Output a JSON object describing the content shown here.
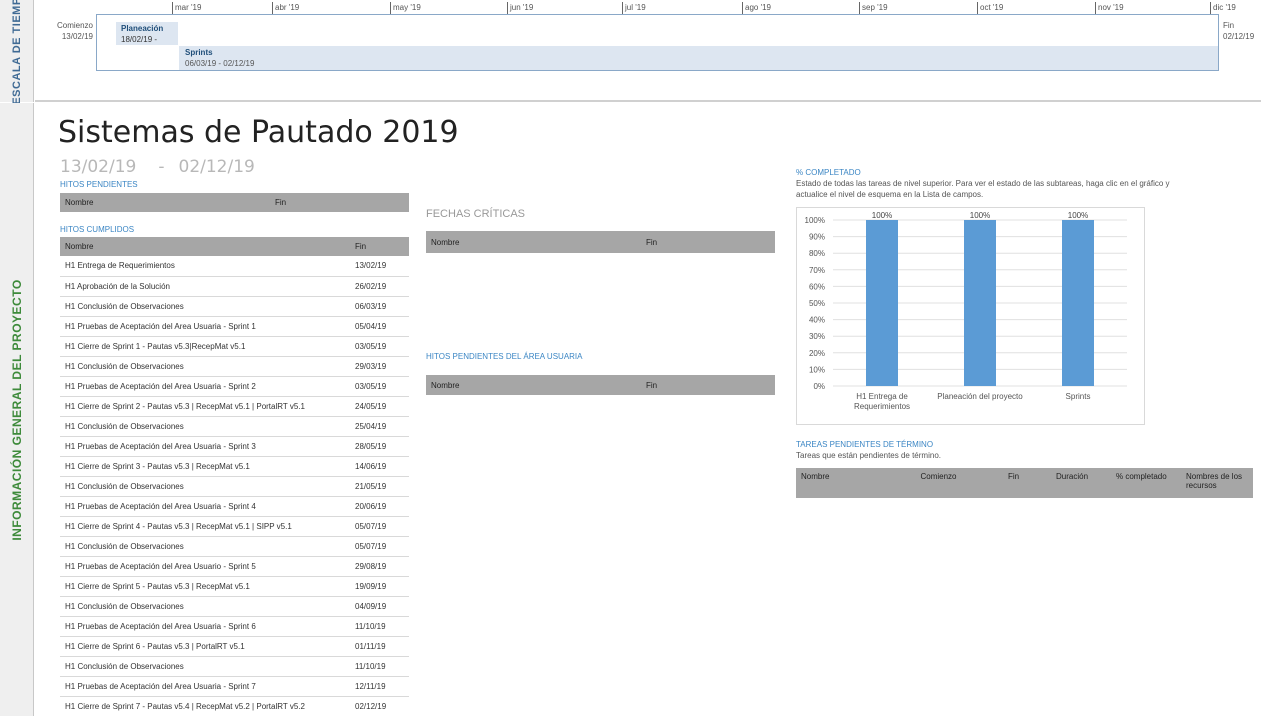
{
  "sidebar": {
    "timeline_label": "ESCALA DE TIEMP",
    "info_label": "INFORMACIÓN GENERAL DEL PROYECTO"
  },
  "timeline": {
    "months": [
      "mar '19",
      "abr '19",
      "may '19",
      "jun '19",
      "jul '19",
      "ago '19",
      "sep '19",
      "oct '19",
      "nov '19",
      "dic '19"
    ],
    "start_label": "Comienzo",
    "start_date": "13/02/19",
    "end_label": "Fin",
    "end_date": "02/12/19",
    "planeacion": {
      "name": "Planeación",
      "dates": "18/02/19 -"
    },
    "sprints": {
      "name": "Sprints",
      "dates": "06/03/19 - 02/12/19"
    }
  },
  "project": {
    "title": "Sistemas de Pautado 2019",
    "start": "13/02/19",
    "sep": "-",
    "end": "02/12/19"
  },
  "hitos_pendientes": {
    "heading": "HITOS PENDIENTES",
    "col_nombre": "Nombre",
    "col_fin": "Fin"
  },
  "hitos_cumplidos": {
    "heading": "HITOS CUMPLIDOS",
    "col_nombre": "Nombre",
    "col_fin": "Fin",
    "rows": [
      {
        "nombre": "H1 Entrega de Requerimientos",
        "fin": "13/02/19"
      },
      {
        "nombre": "H1 Aprobación de la Solución",
        "fin": "26/02/19"
      },
      {
        "nombre": "H1 Conclusión de Observaciones",
        "fin": "06/03/19"
      },
      {
        "nombre": "H1 Pruebas de Aceptación del Area Usuaria - Sprint 1",
        "fin": "05/04/19"
      },
      {
        "nombre": "H1 Cierre de Sprint 1 - Pautas v5.3|RecepMat v5.1",
        "fin": "03/05/19"
      },
      {
        "nombre": "H1 Conclusión de Observaciones",
        "fin": "29/03/19"
      },
      {
        "nombre": "H1 Pruebas de Aceptación del Area Usuaria - Sprint 2",
        "fin": "03/05/19"
      },
      {
        "nombre": "H1 Cierre de Sprint 2 - Pautas v5.3 | RecepMat v5.1 | PortalRT v5.1",
        "fin": "24/05/19"
      },
      {
        "nombre": "H1 Conclusión de Observaciones",
        "fin": "25/04/19"
      },
      {
        "nombre": "H1 Pruebas de Aceptación del Area Usuaria  - Sprint 3",
        "fin": "28/05/19"
      },
      {
        "nombre": "H1 Cierre de Sprint 3 - Pautas v5.3 | RecepMat v5.1",
        "fin": "14/06/19"
      },
      {
        "nombre": "H1 Conclusión de Observaciones",
        "fin": "21/05/19"
      },
      {
        "nombre": "H1 Pruebas de Aceptación del Area Usuaria - Sprint 4",
        "fin": "20/06/19"
      },
      {
        "nombre": "H1 Cierre de Sprint 4 - Pautas v5.3 | RecepMat v5.1 | SIPP v5.1",
        "fin": "05/07/19"
      },
      {
        "nombre": "H1 Conclusión de Observaciones",
        "fin": "05/07/19"
      },
      {
        "nombre": "H1 Pruebas de Aceptación del Area Usuario - Sprint 5",
        "fin": "29/08/19"
      },
      {
        "nombre": "H1 Cierre de Sprint 5 - Pautas v5.3 | RecepMat v5.1",
        "fin": "19/09/19"
      },
      {
        "nombre": "H1 Conclusión de Observaciones",
        "fin": "04/09/19"
      },
      {
        "nombre": "H1 Pruebas de Aceptación del Area Usuaria - Sprint 6",
        "fin": "11/10/19"
      },
      {
        "nombre": "H1 Cierre de Sprint 6 - Pautas v5.3 | PortalRT v5.1",
        "fin": "01/11/19"
      },
      {
        "nombre": "H1 Conclusión de Observaciones",
        "fin": "11/10/19"
      },
      {
        "nombre": "H1 Pruebas de Aceptación del Area Usuaria - Sprint 7",
        "fin": "12/11/19"
      },
      {
        "nombre": "H1 Cierre de Sprint 7 - Pautas v5.4 | RecepMat v5.2 | PortalRT v5.2",
        "fin": "02/12/19"
      }
    ]
  },
  "fechas_criticas": {
    "heading": "FECHAS CRÍTICAS",
    "col_nombre": "Nombre",
    "col_fin": "Fin"
  },
  "hitos_usuaria": {
    "heading": "HITOS PENDIENTES DEL ÁREA USUARIA",
    "col_nombre": "Nombre",
    "col_fin": "Fin"
  },
  "completado": {
    "heading": "% COMPLETADO",
    "description": "Estado de todas las tareas de nivel superior. Para ver el estado de las subtareas, haga clic en el gráfico y actualice el nivel de esquema en la Lista de campos."
  },
  "chart_data": {
    "type": "bar",
    "categories": [
      "H1 Entrega de Requerimientos",
      "Planeación del proyecto",
      "Sprints"
    ],
    "values": [
      100,
      100,
      100
    ],
    "value_labels": [
      "100%",
      "100%",
      "100%"
    ],
    "y_ticks": [
      "0%",
      "10%",
      "20%",
      "30%",
      "40%",
      "50%",
      "60%",
      "70%",
      "80%",
      "90%",
      "100%"
    ],
    "ylim": [
      0,
      100
    ],
    "grid": true,
    "bar_color": "#5b9bd5"
  },
  "tareas_pendientes": {
    "heading": "TAREAS PENDIENTES DE TÉRMINO",
    "description": "Tareas que están pendientes de término.",
    "columns": [
      "Nombre",
      "Comienzo",
      "Fin",
      "Duración",
      "% completado",
      "Nombres de los recursos"
    ]
  }
}
